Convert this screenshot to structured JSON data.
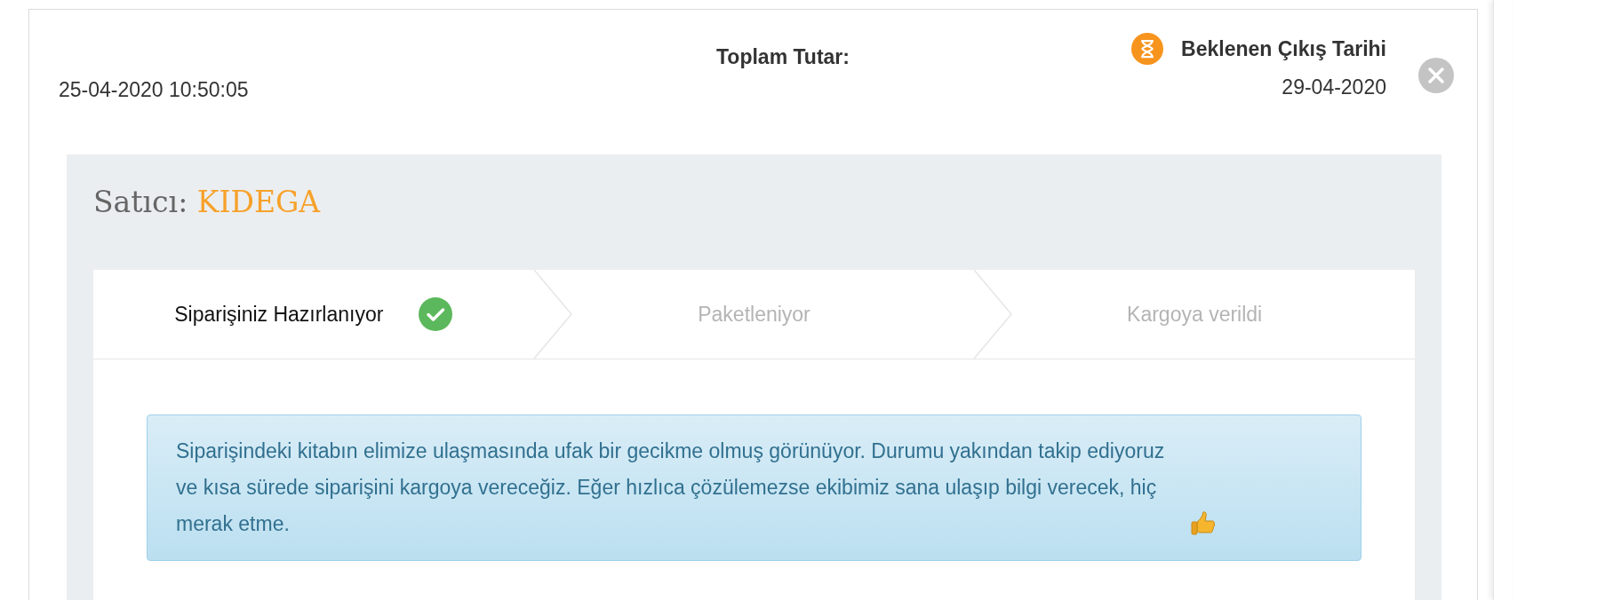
{
  "order": {
    "date": "25-04-2020 10:50:05",
    "total_label": "Toplam Tutar:",
    "expected_label": "Beklenen Çıkış Tarihi",
    "expected_date": "29-04-2020"
  },
  "seller": {
    "label": "Satıcı:",
    "name": "KIDEGA"
  },
  "steps": [
    {
      "label": "Siparişiniz Hazırlanıyor",
      "completed": true
    },
    {
      "label": "Paketleniyor",
      "completed": false
    },
    {
      "label": "Kargoya verildi",
      "completed": false
    }
  ],
  "alert": {
    "text": "Siparişindeki kitabın elimize ulaşmasında ufak bir gecikme olmuş görünüyor. Durumu yakından takip ediyoruz ve kısa sürede siparişini kargoya vereceğiz. Eğer hızlıca çözülemezse ekibimiz sana ulaşıp bilgi verecek, hiç merak etme."
  }
}
